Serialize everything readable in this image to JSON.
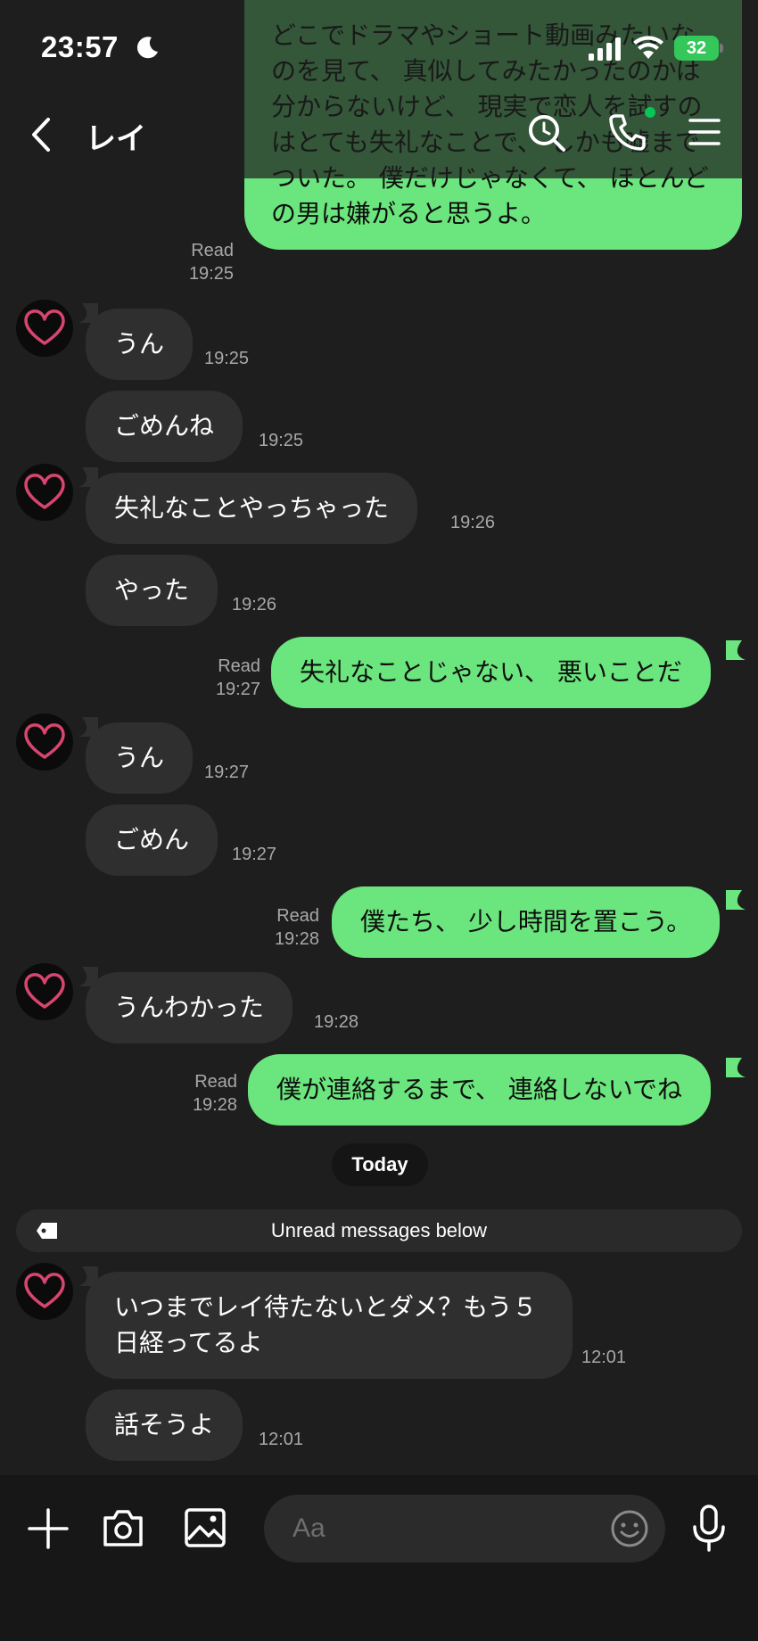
{
  "status_bar": {
    "time": "23:57",
    "battery": "32"
  },
  "header": {
    "title": "レイ"
  },
  "messages": [
    {
      "dir": "out",
      "text": "どこでドラマやショート動画みたいなのを見て、 真似してみたかったのかは分からないけど、 現実で恋人を試すのはとても失礼なことで、 しかも嘘までついた。 僕だけじゃなくて、 ほとんどの男は嫌がると思うよ。",
      "read": "Read",
      "time": "19:25"
    },
    {
      "dir": "in",
      "text": "うん",
      "time": "19:25"
    },
    {
      "dir": "in",
      "text": "ごめんね",
      "time": "19:25"
    },
    {
      "dir": "in",
      "text": "失礼なことやっちゃった",
      "time": "19:26"
    },
    {
      "dir": "in",
      "text": "やった",
      "time": "19:26"
    },
    {
      "dir": "out",
      "text": "失礼なことじゃない、 悪いことだ",
      "read": "Read",
      "time": "19:27"
    },
    {
      "dir": "in",
      "text": "うん",
      "time": "19:27"
    },
    {
      "dir": "in",
      "text": "ごめん",
      "time": "19:27"
    },
    {
      "dir": "out",
      "text": "僕たち、 少し時間を置こう。",
      "read": "Read",
      "time": "19:28"
    },
    {
      "dir": "in",
      "text": "うんわかった",
      "time": "19:28"
    },
    {
      "dir": "out",
      "text": "僕が連絡するまで、 連絡しないでね",
      "read": "Read",
      "time": "19:28"
    },
    {
      "dir": "in",
      "text": "いつまでレイ待たないとダメ？もう５日経ってるよ",
      "time": "12:01"
    },
    {
      "dir": "in",
      "text": "話そうよ",
      "time": "12:01"
    }
  ],
  "date_divider": "Today",
  "unread_label": "Unread messages below",
  "composer": {
    "placeholder": "Aa"
  },
  "colors": {
    "outgoing_bubble": "#6be57d",
    "incoming_bubble": "#2f2f2f",
    "background": "#1e1e1e",
    "online_dot": "#06c755"
  }
}
